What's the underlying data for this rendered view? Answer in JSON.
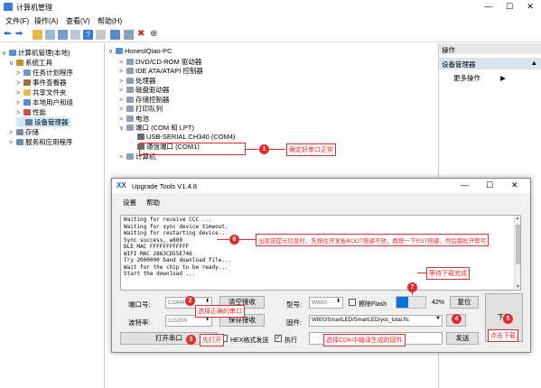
{
  "window": {
    "title": "计算机管理",
    "menus": [
      "文件(F)",
      "操作(A)",
      "查看(V)",
      "帮助(H)"
    ]
  },
  "left_tree": [
    {
      "label": "计算机管理(本地)",
      "indent": 0,
      "arrow": "∨",
      "icon": "computer-icon"
    },
    {
      "label": "系统工具",
      "indent": 1,
      "arrow": "∨",
      "icon": "tools-icon"
    },
    {
      "label": "任务计划程序",
      "indent": 2,
      "arrow": ">",
      "icon": "clock-icon"
    },
    {
      "label": "事件查看器",
      "indent": 2,
      "arrow": ">",
      "icon": "event-icon"
    },
    {
      "label": "共享文件夹",
      "indent": 2,
      "arrow": ">",
      "icon": "folder-icon"
    },
    {
      "label": "本地用户和组",
      "indent": 2,
      "arrow": ">",
      "icon": "users-icon"
    },
    {
      "label": "性能",
      "indent": 2,
      "arrow": ">",
      "icon": "performance-icon"
    },
    {
      "label": "设备管理器",
      "indent": 2,
      "arrow": "",
      "icon": "device-manager-icon"
    },
    {
      "label": "存储",
      "indent": 1,
      "arrow": ">",
      "icon": "storage-icon"
    },
    {
      "label": "服务和应用程序",
      "indent": 1,
      "arrow": ">",
      "icon": "services-icon"
    }
  ],
  "device_tree": [
    {
      "label": "HonestQiao-PC",
      "indent": 0,
      "arrow": "∨"
    },
    {
      "label": "DVD/CD-ROM 驱动器",
      "indent": 1,
      "arrow": ">"
    },
    {
      "label": "IDE ATA/ATAPI 控制器",
      "indent": 1,
      "arrow": ">"
    },
    {
      "label": "处理器",
      "indent": 1,
      "arrow": ">"
    },
    {
      "label": "磁盘驱动器",
      "indent": 1,
      "arrow": ">"
    },
    {
      "label": "存储控制器",
      "indent": 1,
      "arrow": ">"
    },
    {
      "label": "打印队列",
      "indent": 1,
      "arrow": ">"
    },
    {
      "label": "电池",
      "indent": 1,
      "arrow": ">"
    },
    {
      "label": "端口 (COM 和 LPT)",
      "indent": 1,
      "arrow": "∨"
    },
    {
      "label": "USB-SERIAL CH340 (COM4)",
      "indent": 2,
      "arrow": ""
    },
    {
      "label": "通信端口 (COM1)",
      "indent": 2,
      "arrow": ""
    },
    {
      "label": "计算机",
      "indent": 1,
      "arrow": ">"
    }
  ],
  "actions": {
    "header": "操作",
    "selected": "设备管理器",
    "more": "更多操作"
  },
  "dialog": {
    "title": "Upgrade Tools V1.4.8",
    "menus": [
      "设置",
      "帮助"
    ],
    "console_lines": [
      "Waiting for receive CCC ...",
      "Waiting for sync device timeout.",
      "Waiting for restarting device...",
      "Sync success, w800",
      "BLE  MAC FFFFFFFFFFFF",
      "WIFI MAC 2863CD55E746",
      "Try 2000000 band download file...",
      "Wait for the chip to be ready...",
      "Start the download ..."
    ],
    "port_label": "端口号:",
    "port_value": "COM4",
    "clear_recv": "清空接收",
    "model_label": "型号:",
    "model_value": "W800",
    "erase_flash": "擦除Flash",
    "progress_text": "42%",
    "progress": 0.42,
    "reset": "复位",
    "baud_label": "波特率:",
    "baud_value": "115200",
    "save_recv": "保存接收",
    "firmware_label": "固件:",
    "firmware_value": "W800/SmartLED/SmartLED/yoc_total.fls",
    "browse": "...",
    "download": "下载",
    "open_port": "打开串口",
    "hex_send": "HEX格式发送",
    "execute": "执行",
    "send": "发送"
  },
  "annotations": {
    "a1": {
      "num": "1",
      "text": "确定好串口正常"
    },
    "a2": {
      "num": "2",
      "text": "选择正确的串口"
    },
    "a3": {
      "num": "3",
      "text": "先打开"
    },
    "a4": {
      "num": "4",
      "text": "选择CDK中编译生成的固件"
    },
    "a5": {
      "num": "5",
      "text": "点击下载"
    },
    "a6": {
      "num": "6",
      "text": "出现该提示信息时，先按住开发板BOOT按键不放，再按一下RST按键，然后都松开即可"
    },
    "a7": {
      "num": "7",
      "text": "等待下载完成"
    }
  },
  "colors": {
    "accent": "#e52a2a",
    "progress": "#0a74da",
    "selected": "#cce8ff"
  }
}
